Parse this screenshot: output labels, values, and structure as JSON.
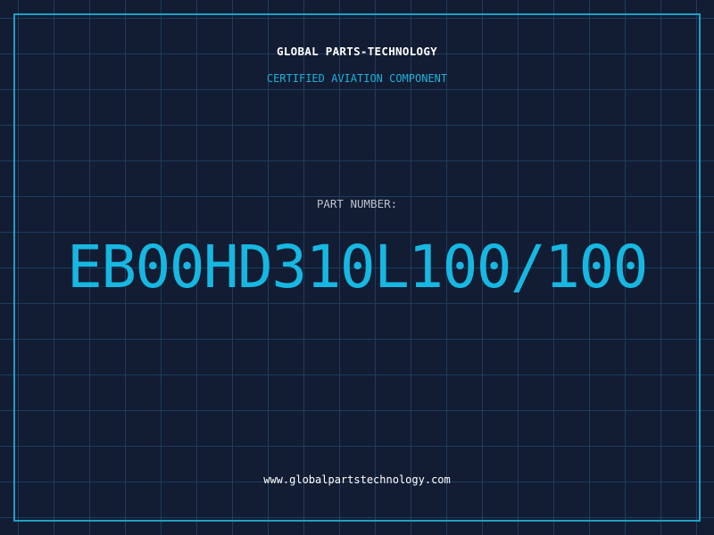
{
  "header": {
    "company": "GLOBAL PARTS-TECHNOLOGY",
    "tagline": "CERTIFIED AVIATION COMPONENT"
  },
  "part": {
    "label": "PART NUMBER:",
    "number": "EB00HD310L100/100"
  },
  "footer": {
    "url": "www.globalpartstechnology.com"
  },
  "colors": {
    "background": "#121c33",
    "grid": "#1d3d5c",
    "accent": "#16b8e2",
    "frame": "#1fa0c4",
    "label": "#b8c2cf",
    "text": "#ffffff"
  }
}
